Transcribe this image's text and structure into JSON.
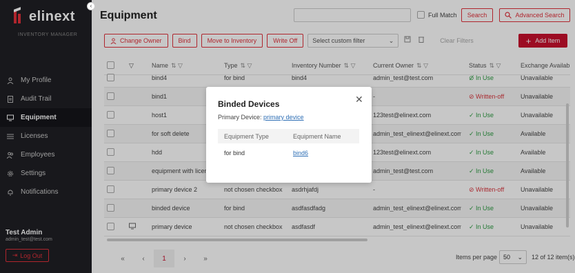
{
  "app": {
    "logo_text": "elinext",
    "logo_sub": "INVENTORY MANAGER",
    "collapse_icon": "chevron-left-icon",
    "accent": "#c8102e"
  },
  "sidebar": {
    "items": [
      {
        "label": "My Profile",
        "icon": "user-icon"
      },
      {
        "label": "Audit Trail",
        "icon": "document-icon"
      },
      {
        "label": "Equipment",
        "icon": "monitor-icon",
        "active": true
      },
      {
        "label": "Licenses",
        "icon": "list-icon"
      },
      {
        "label": "Employees",
        "icon": "users-icon"
      },
      {
        "label": "Settings",
        "icon": "gear-icon"
      },
      {
        "label": "Notifications",
        "icon": "bell-icon"
      }
    ],
    "user_name": "Test Admin",
    "user_email": "admin_test@test.com",
    "logout_label": "Log Out"
  },
  "header": {
    "title": "Equipment",
    "search_placeholder": "",
    "full_match_label": "Full Match",
    "search_label": "Search",
    "advanced_search_label": "Advanced Search"
  },
  "toolbar": {
    "change_owner": "Change Owner",
    "bind": "Bind",
    "move_to_inventory": "Move to Inventory",
    "write_off": "Write Off",
    "custom_filter_placeholder": "Select custom filter",
    "clear_filters": "Clear Filters",
    "add_item": "Add Item"
  },
  "table": {
    "columns": [
      "Name",
      "Type",
      "Inventory Number",
      "Current Owner",
      "Status",
      "Exchange Availab"
    ],
    "rows": [
      {
        "name": "bind4",
        "type": "for bind",
        "inv": "bind4",
        "owner": "admin_test@test.com",
        "status": "In Use",
        "exch": "Unavailable"
      },
      {
        "name": "bind1",
        "type": "",
        "inv": "",
        "owner": "-",
        "status": "Written-off",
        "exch": "Unavailable"
      },
      {
        "name": "host1",
        "type": "",
        "inv": "",
        "owner": "123test@elinext.com",
        "status": "In Use",
        "exch": "Unavailable"
      },
      {
        "name": "for soft delete",
        "type": "",
        "inv": "",
        "owner": "admin_test_elinext@elinext.com",
        "status": "In Use",
        "exch": "Available"
      },
      {
        "name": "hdd",
        "type": "",
        "inv": "",
        "owner": "123test@elinext.com",
        "status": "In Use",
        "exch": "Available"
      },
      {
        "name": "equipment with licen",
        "type": "",
        "inv": "",
        "owner": "admin_test@test.com",
        "status": "In Use",
        "exch": "Available"
      },
      {
        "name": "primary device 2",
        "type": "not chosen checkbox",
        "inv": "asdrhjafdj",
        "owner": "-",
        "status": "Written-off",
        "exch": "Unavailable"
      },
      {
        "name": "binded device",
        "type": "for bind",
        "inv": "asdfasdfadg",
        "owner": "admin_test_elinext@elinext.com",
        "status": "In Use",
        "exch": "Unavailable"
      },
      {
        "name": "primary device",
        "type": "not chosen checkbox",
        "inv": "asdfasdf",
        "owner": "admin_test_elinext@elinext.com",
        "status": "In Use",
        "exch": "Unavailable"
      }
    ]
  },
  "pagination": {
    "first": "«",
    "prev": "‹",
    "current": "1",
    "next": "›",
    "last": "»",
    "items_per_page_label": "Items per page",
    "items_per_page_value": "50",
    "count": "12 of 12 item(s)"
  },
  "modal": {
    "title": "Binded Devices",
    "primary_label": "Primary Device:",
    "primary_link": "primary device",
    "col_type": "Equipment Type",
    "col_name": "Equipment Name",
    "row_type": "for bind",
    "row_name": "bind6"
  }
}
